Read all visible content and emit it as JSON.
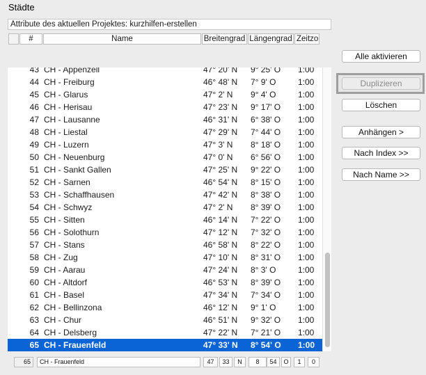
{
  "window": {
    "title": "Städte"
  },
  "project": {
    "label": "Attribute des aktuellen Projektes: kurzhilfen-erstellen"
  },
  "columns": {
    "sel": "",
    "num": "#",
    "name": "Name",
    "lat": "Breitengrad",
    "lon": "Längengrad",
    "tz": "Zeitzo"
  },
  "rows": [
    {
      "num": "43",
      "name": "CH - Appenzell",
      "lat": "47° 20' N",
      "lon": "9° 25' O",
      "tz": "1:00"
    },
    {
      "num": "44",
      "name": "CH - Freiburg",
      "lat": "46° 48' N",
      "lon": "7° 9' O",
      "tz": "1:00"
    },
    {
      "num": "45",
      "name": "CH - Glarus",
      "lat": "47° 2' N",
      "lon": "9° 4' O",
      "tz": "1:00"
    },
    {
      "num": "46",
      "name": "CH - Herisau",
      "lat": "47° 23' N",
      "lon": "9° 17' O",
      "tz": "1:00"
    },
    {
      "num": "47",
      "name": "CH - Lausanne",
      "lat": "46° 31' N",
      "lon": "6° 38' O",
      "tz": "1:00"
    },
    {
      "num": "48",
      "name": "CH - Liestal",
      "lat": "47° 29' N",
      "lon": "7° 44' O",
      "tz": "1:00"
    },
    {
      "num": "49",
      "name": "CH - Luzern",
      "lat": "47° 3' N",
      "lon": "8° 18' O",
      "tz": "1:00"
    },
    {
      "num": "50",
      "name": "CH - Neuenburg",
      "lat": "47° 0' N",
      "lon": "6° 56' O",
      "tz": "1:00"
    },
    {
      "num": "51",
      "name": "CH - Sankt Gallen",
      "lat": "47° 25' N",
      "lon": "9° 22' O",
      "tz": "1:00"
    },
    {
      "num": "52",
      "name": "CH - Sarnen",
      "lat": "46° 54' N",
      "lon": "8° 15' O",
      "tz": "1:00"
    },
    {
      "num": "53",
      "name": "CH - Schaffhausen",
      "lat": "47° 42' N",
      "lon": "8° 38' O",
      "tz": "1:00"
    },
    {
      "num": "54",
      "name": "CH - Schwyz",
      "lat": "47° 2' N",
      "lon": "8° 39' O",
      "tz": "1:00"
    },
    {
      "num": "55",
      "name": "CH - Sitten",
      "lat": "46° 14' N",
      "lon": "7° 22' O",
      "tz": "1:00"
    },
    {
      "num": "56",
      "name": "CH - Solothurn",
      "lat": "47° 12' N",
      "lon": "7° 32' O",
      "tz": "1:00"
    },
    {
      "num": "57",
      "name": "CH - Stans",
      "lat": "46° 58' N",
      "lon": "8° 22' O",
      "tz": "1:00"
    },
    {
      "num": "58",
      "name": "CH - Zug",
      "lat": "47° 10' N",
      "lon": "8° 31' O",
      "tz": "1:00"
    },
    {
      "num": "59",
      "name": "CH - Aarau",
      "lat": "47° 24' N",
      "lon": "8° 3' O",
      "tz": "1:00"
    },
    {
      "num": "60",
      "name": "CH - Altdorf",
      "lat": "46° 53' N",
      "lon": "8° 39' O",
      "tz": "1:00"
    },
    {
      "num": "61",
      "name": "CH - Basel",
      "lat": "47° 34' N",
      "lon": "7° 34' O",
      "tz": "1:00"
    },
    {
      "num": "62",
      "name": "CH - Bellinzona",
      "lat": "46° 12' N",
      "lon": "9° 1' O",
      "tz": "1:00"
    },
    {
      "num": "63",
      "name": "CH - Chur",
      "lat": "46° 51' N",
      "lon": "9° 32' O",
      "tz": "1:00"
    },
    {
      "num": "64",
      "name": "CH - Delsberg",
      "lat": "47° 22' N",
      "lon": "7° 21' O",
      "tz": "1:00"
    },
    {
      "num": "65",
      "name": "CH - Frauenfeld",
      "lat": "47° 33' N",
      "lon": "8° 54' O",
      "tz": "1:00",
      "selected": true
    }
  ],
  "buttons": {
    "activate_all": "Alle aktivieren",
    "duplicate": "Duplizieren",
    "delete": "Löschen",
    "append": "Anhängen >",
    "by_index": "Nach Index >>",
    "by_name": "Nach Name >>"
  },
  "footer": {
    "index": "65",
    "name": "CH - Frauenfeld",
    "lat_deg": "47",
    "lat_min": "33",
    "lat_dir": "N",
    "lon_deg": "8",
    "lon_min": "54",
    "lon_dir": "O",
    "tz_h": "1",
    "tz_m": "0"
  },
  "colors": {
    "selection": "#0a64d6",
    "window_bg": "#ececec"
  }
}
